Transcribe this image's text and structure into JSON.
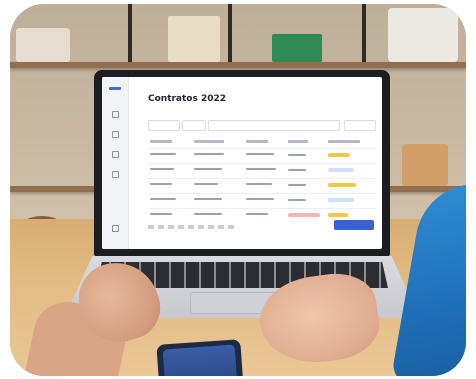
{
  "screen": {
    "breadcrumb": "",
    "title": "Contratos 2022"
  },
  "colors": {
    "accent": "#3761cf",
    "badge_warning": "#f2c64a",
    "badge_info": "#cfe0ff",
    "badge_danger": "#f5b4b4",
    "sleeve": "#1f6fb8",
    "desk": "#e2bb84"
  },
  "icons": [
    "sidebar-logo-icon",
    "sidebar-nav-icon"
  ]
}
